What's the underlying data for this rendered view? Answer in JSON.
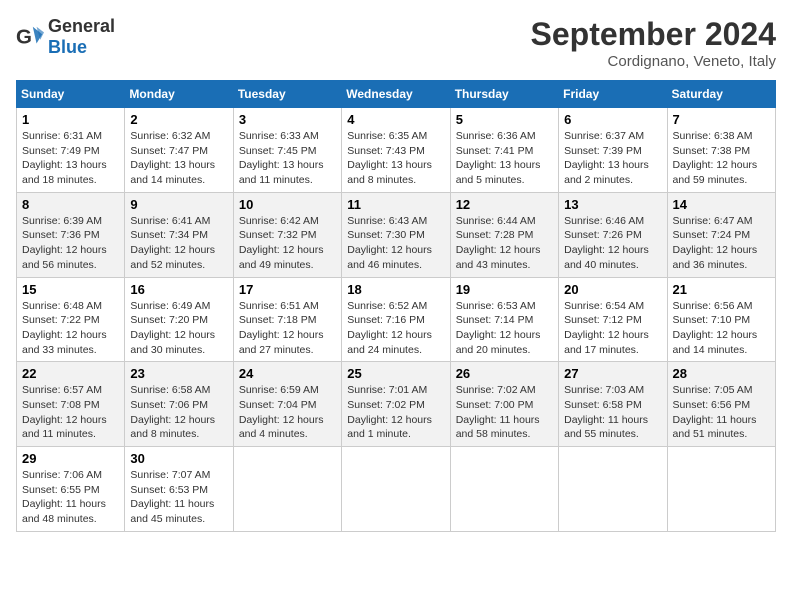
{
  "header": {
    "logo": {
      "general": "General",
      "blue": "Blue"
    },
    "title": "September 2024",
    "location": "Cordignano, Veneto, Italy"
  },
  "weekdays": [
    "Sunday",
    "Monday",
    "Tuesday",
    "Wednesday",
    "Thursday",
    "Friday",
    "Saturday"
  ],
  "weeks": [
    [
      {
        "day": 1,
        "sunrise": "6:31 AM",
        "sunset": "7:49 PM",
        "daylight": "13 hours and 18 minutes."
      },
      {
        "day": 2,
        "sunrise": "6:32 AM",
        "sunset": "7:47 PM",
        "daylight": "13 hours and 14 minutes."
      },
      {
        "day": 3,
        "sunrise": "6:33 AM",
        "sunset": "7:45 PM",
        "daylight": "13 hours and 11 minutes."
      },
      {
        "day": 4,
        "sunrise": "6:35 AM",
        "sunset": "7:43 PM",
        "daylight": "13 hours and 8 minutes."
      },
      {
        "day": 5,
        "sunrise": "6:36 AM",
        "sunset": "7:41 PM",
        "daylight": "13 hours and 5 minutes."
      },
      {
        "day": 6,
        "sunrise": "6:37 AM",
        "sunset": "7:39 PM",
        "daylight": "13 hours and 2 minutes."
      },
      {
        "day": 7,
        "sunrise": "6:38 AM",
        "sunset": "7:38 PM",
        "daylight": "12 hours and 59 minutes."
      }
    ],
    [
      {
        "day": 8,
        "sunrise": "6:39 AM",
        "sunset": "7:36 PM",
        "daylight": "12 hours and 56 minutes."
      },
      {
        "day": 9,
        "sunrise": "6:41 AM",
        "sunset": "7:34 PM",
        "daylight": "12 hours and 52 minutes."
      },
      {
        "day": 10,
        "sunrise": "6:42 AM",
        "sunset": "7:32 PM",
        "daylight": "12 hours and 49 minutes."
      },
      {
        "day": 11,
        "sunrise": "6:43 AM",
        "sunset": "7:30 PM",
        "daylight": "12 hours and 46 minutes."
      },
      {
        "day": 12,
        "sunrise": "6:44 AM",
        "sunset": "7:28 PM",
        "daylight": "12 hours and 43 minutes."
      },
      {
        "day": 13,
        "sunrise": "6:46 AM",
        "sunset": "7:26 PM",
        "daylight": "12 hours and 40 minutes."
      },
      {
        "day": 14,
        "sunrise": "6:47 AM",
        "sunset": "7:24 PM",
        "daylight": "12 hours and 36 minutes."
      }
    ],
    [
      {
        "day": 15,
        "sunrise": "6:48 AM",
        "sunset": "7:22 PM",
        "daylight": "12 hours and 33 minutes."
      },
      {
        "day": 16,
        "sunrise": "6:49 AM",
        "sunset": "7:20 PM",
        "daylight": "12 hours and 30 minutes."
      },
      {
        "day": 17,
        "sunrise": "6:51 AM",
        "sunset": "7:18 PM",
        "daylight": "12 hours and 27 minutes."
      },
      {
        "day": 18,
        "sunrise": "6:52 AM",
        "sunset": "7:16 PM",
        "daylight": "12 hours and 24 minutes."
      },
      {
        "day": 19,
        "sunrise": "6:53 AM",
        "sunset": "7:14 PM",
        "daylight": "12 hours and 20 minutes."
      },
      {
        "day": 20,
        "sunrise": "6:54 AM",
        "sunset": "7:12 PM",
        "daylight": "12 hours and 17 minutes."
      },
      {
        "day": 21,
        "sunrise": "6:56 AM",
        "sunset": "7:10 PM",
        "daylight": "12 hours and 14 minutes."
      }
    ],
    [
      {
        "day": 22,
        "sunrise": "6:57 AM",
        "sunset": "7:08 PM",
        "daylight": "12 hours and 11 minutes."
      },
      {
        "day": 23,
        "sunrise": "6:58 AM",
        "sunset": "7:06 PM",
        "daylight": "12 hours and 8 minutes."
      },
      {
        "day": 24,
        "sunrise": "6:59 AM",
        "sunset": "7:04 PM",
        "daylight": "12 hours and 4 minutes."
      },
      {
        "day": 25,
        "sunrise": "7:01 AM",
        "sunset": "7:02 PM",
        "daylight": "12 hours and 1 minute."
      },
      {
        "day": 26,
        "sunrise": "7:02 AM",
        "sunset": "7:00 PM",
        "daylight": "11 hours and 58 minutes."
      },
      {
        "day": 27,
        "sunrise": "7:03 AM",
        "sunset": "6:58 PM",
        "daylight": "11 hours and 55 minutes."
      },
      {
        "day": 28,
        "sunrise": "7:05 AM",
        "sunset": "6:56 PM",
        "daylight": "11 hours and 51 minutes."
      }
    ],
    [
      {
        "day": 29,
        "sunrise": "7:06 AM",
        "sunset": "6:55 PM",
        "daylight": "11 hours and 48 minutes."
      },
      {
        "day": 30,
        "sunrise": "7:07 AM",
        "sunset": "6:53 PM",
        "daylight": "11 hours and 45 minutes."
      },
      null,
      null,
      null,
      null,
      null
    ]
  ]
}
